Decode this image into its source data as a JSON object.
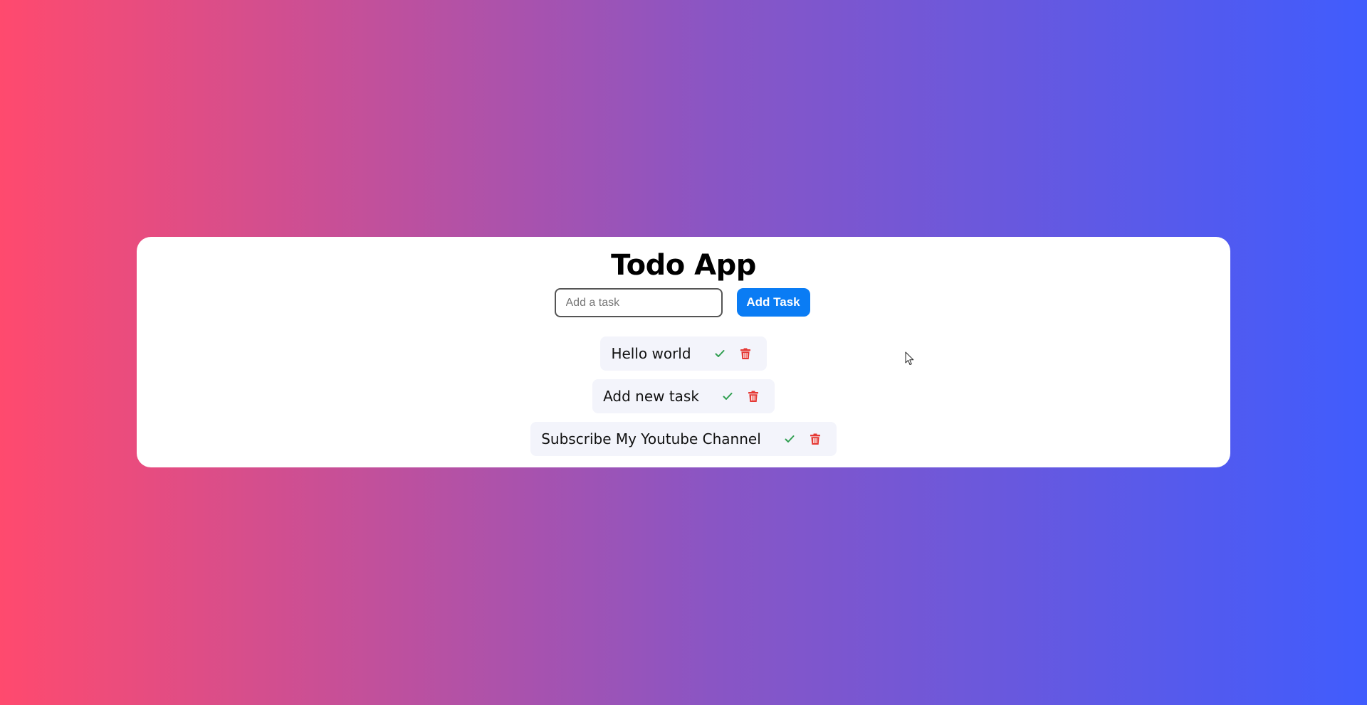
{
  "app": {
    "title": "Todo App"
  },
  "input": {
    "placeholder": "Add a task",
    "value": ""
  },
  "add_button": {
    "label": "Add Task"
  },
  "tasks": [
    {
      "text": "Hello world"
    },
    {
      "text": "Add new task"
    },
    {
      "text": "Subscribe My Youtube Channel"
    }
  ],
  "icons": {
    "complete": "check-icon",
    "delete": "trash-icon"
  },
  "colors": {
    "gradient_start": "#ff4a6e",
    "gradient_end": "#405cfd",
    "button": "#0a7cf4",
    "check": "#2e9e4f",
    "delete": "#e53935",
    "item_bg": "#f3f4fb"
  }
}
